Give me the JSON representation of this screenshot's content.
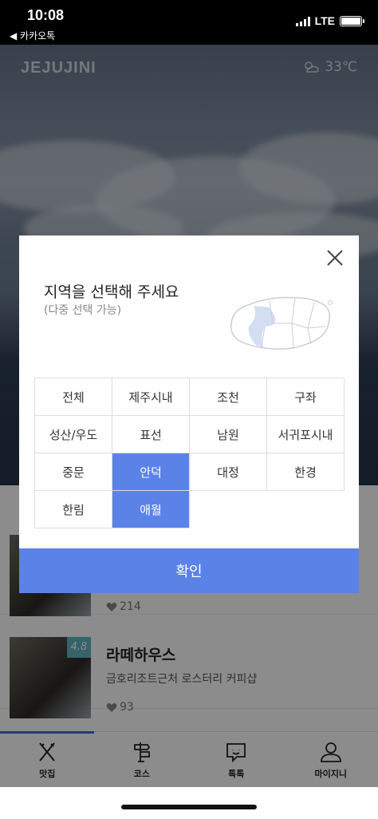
{
  "status_bar": {
    "time": "10:08",
    "back_label": "◀ 카카오톡",
    "network": "LTE"
  },
  "header": {
    "logo": "JEJUJINI",
    "weather_icon": "partly-cloudy-icon",
    "temperature": "33℃"
  },
  "list": [
    {
      "likes": "214"
    },
    {
      "name": "라떼하우스",
      "description": "금호리조트근처 로스터리 커피샵",
      "likes": "93",
      "rating": "4.8"
    }
  ],
  "modal": {
    "title": "지역을 선택해 주세요",
    "subtitle": "(다중 선택 가능)",
    "regions": [
      {
        "label": "전체",
        "selected": false
      },
      {
        "label": "제주시내",
        "selected": false
      },
      {
        "label": "조천",
        "selected": false
      },
      {
        "label": "구좌",
        "selected": false
      },
      {
        "label": "성산/우도",
        "selected": false
      },
      {
        "label": "표선",
        "selected": false
      },
      {
        "label": "남원",
        "selected": false
      },
      {
        "label": "서귀포시내",
        "selected": false
      },
      {
        "label": "중문",
        "selected": false
      },
      {
        "label": "안덕",
        "selected": true
      },
      {
        "label": "대정",
        "selected": false
      },
      {
        "label": "한경",
        "selected": false
      },
      {
        "label": "한림",
        "selected": false
      },
      {
        "label": "애월",
        "selected": true
      }
    ],
    "confirm_label": "확인"
  },
  "tabs": [
    {
      "label": "맛집",
      "icon": "fork-knife-icon",
      "active": true
    },
    {
      "label": "코스",
      "icon": "signpost-icon",
      "active": false
    },
    {
      "label": "톡톡",
      "icon": "chat-bubble-icon",
      "active": false
    },
    {
      "label": "마이지니",
      "icon": "person-icon",
      "active": false
    }
  ],
  "colors": {
    "accent": "#5b82e6",
    "rating_badge": "#5fb4c2"
  }
}
